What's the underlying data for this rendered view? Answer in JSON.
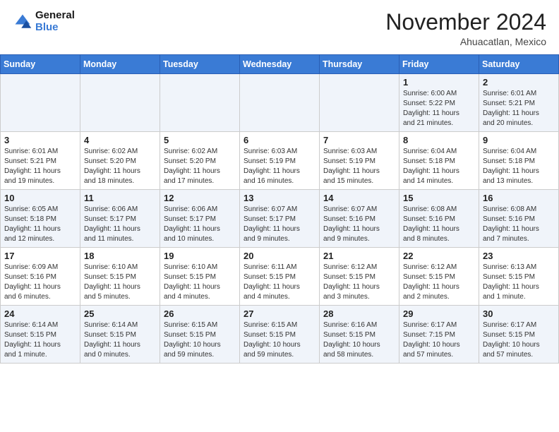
{
  "header": {
    "logo_general": "General",
    "logo_blue": "Blue",
    "month_title": "November 2024",
    "location": "Ahuacatlan, Mexico"
  },
  "days_of_week": [
    "Sunday",
    "Monday",
    "Tuesday",
    "Wednesday",
    "Thursday",
    "Friday",
    "Saturday"
  ],
  "weeks": [
    [
      {
        "day": "",
        "info": ""
      },
      {
        "day": "",
        "info": ""
      },
      {
        "day": "",
        "info": ""
      },
      {
        "day": "",
        "info": ""
      },
      {
        "day": "",
        "info": ""
      },
      {
        "day": "1",
        "info": "Sunrise: 6:00 AM\nSunset: 5:22 PM\nDaylight: 11 hours\nand 21 minutes."
      },
      {
        "day": "2",
        "info": "Sunrise: 6:01 AM\nSunset: 5:21 PM\nDaylight: 11 hours\nand 20 minutes."
      }
    ],
    [
      {
        "day": "3",
        "info": "Sunrise: 6:01 AM\nSunset: 5:21 PM\nDaylight: 11 hours\nand 19 minutes."
      },
      {
        "day": "4",
        "info": "Sunrise: 6:02 AM\nSunset: 5:20 PM\nDaylight: 11 hours\nand 18 minutes."
      },
      {
        "day": "5",
        "info": "Sunrise: 6:02 AM\nSunset: 5:20 PM\nDaylight: 11 hours\nand 17 minutes."
      },
      {
        "day": "6",
        "info": "Sunrise: 6:03 AM\nSunset: 5:19 PM\nDaylight: 11 hours\nand 16 minutes."
      },
      {
        "day": "7",
        "info": "Sunrise: 6:03 AM\nSunset: 5:19 PM\nDaylight: 11 hours\nand 15 minutes."
      },
      {
        "day": "8",
        "info": "Sunrise: 6:04 AM\nSunset: 5:18 PM\nDaylight: 11 hours\nand 14 minutes."
      },
      {
        "day": "9",
        "info": "Sunrise: 6:04 AM\nSunset: 5:18 PM\nDaylight: 11 hours\nand 13 minutes."
      }
    ],
    [
      {
        "day": "10",
        "info": "Sunrise: 6:05 AM\nSunset: 5:18 PM\nDaylight: 11 hours\nand 12 minutes."
      },
      {
        "day": "11",
        "info": "Sunrise: 6:06 AM\nSunset: 5:17 PM\nDaylight: 11 hours\nand 11 minutes."
      },
      {
        "day": "12",
        "info": "Sunrise: 6:06 AM\nSunset: 5:17 PM\nDaylight: 11 hours\nand 10 minutes."
      },
      {
        "day": "13",
        "info": "Sunrise: 6:07 AM\nSunset: 5:17 PM\nDaylight: 11 hours\nand 9 minutes."
      },
      {
        "day": "14",
        "info": "Sunrise: 6:07 AM\nSunset: 5:16 PM\nDaylight: 11 hours\nand 9 minutes."
      },
      {
        "day": "15",
        "info": "Sunrise: 6:08 AM\nSunset: 5:16 PM\nDaylight: 11 hours\nand 8 minutes."
      },
      {
        "day": "16",
        "info": "Sunrise: 6:08 AM\nSunset: 5:16 PM\nDaylight: 11 hours\nand 7 minutes."
      }
    ],
    [
      {
        "day": "17",
        "info": "Sunrise: 6:09 AM\nSunset: 5:16 PM\nDaylight: 11 hours\nand 6 minutes."
      },
      {
        "day": "18",
        "info": "Sunrise: 6:10 AM\nSunset: 5:15 PM\nDaylight: 11 hours\nand 5 minutes."
      },
      {
        "day": "19",
        "info": "Sunrise: 6:10 AM\nSunset: 5:15 PM\nDaylight: 11 hours\nand 4 minutes."
      },
      {
        "day": "20",
        "info": "Sunrise: 6:11 AM\nSunset: 5:15 PM\nDaylight: 11 hours\nand 4 minutes."
      },
      {
        "day": "21",
        "info": "Sunrise: 6:12 AM\nSunset: 5:15 PM\nDaylight: 11 hours\nand 3 minutes."
      },
      {
        "day": "22",
        "info": "Sunrise: 6:12 AM\nSunset: 5:15 PM\nDaylight: 11 hours\nand 2 minutes."
      },
      {
        "day": "23",
        "info": "Sunrise: 6:13 AM\nSunset: 5:15 PM\nDaylight: 11 hours\nand 1 minute."
      }
    ],
    [
      {
        "day": "24",
        "info": "Sunrise: 6:14 AM\nSunset: 5:15 PM\nDaylight: 11 hours\nand 1 minute."
      },
      {
        "day": "25",
        "info": "Sunrise: 6:14 AM\nSunset: 5:15 PM\nDaylight: 11 hours\nand 0 minutes."
      },
      {
        "day": "26",
        "info": "Sunrise: 6:15 AM\nSunset: 5:15 PM\nDaylight: 10 hours\nand 59 minutes."
      },
      {
        "day": "27",
        "info": "Sunrise: 6:15 AM\nSunset: 5:15 PM\nDaylight: 10 hours\nand 59 minutes."
      },
      {
        "day": "28",
        "info": "Sunrise: 6:16 AM\nSunset: 5:15 PM\nDaylight: 10 hours\nand 58 minutes."
      },
      {
        "day": "29",
        "info": "Sunrise: 6:17 AM\nSunset: 7:15 PM\nDaylight: 10 hours\nand 57 minutes."
      },
      {
        "day": "30",
        "info": "Sunrise: 6:17 AM\nSunset: 5:15 PM\nDaylight: 10 hours\nand 57 minutes."
      }
    ]
  ]
}
